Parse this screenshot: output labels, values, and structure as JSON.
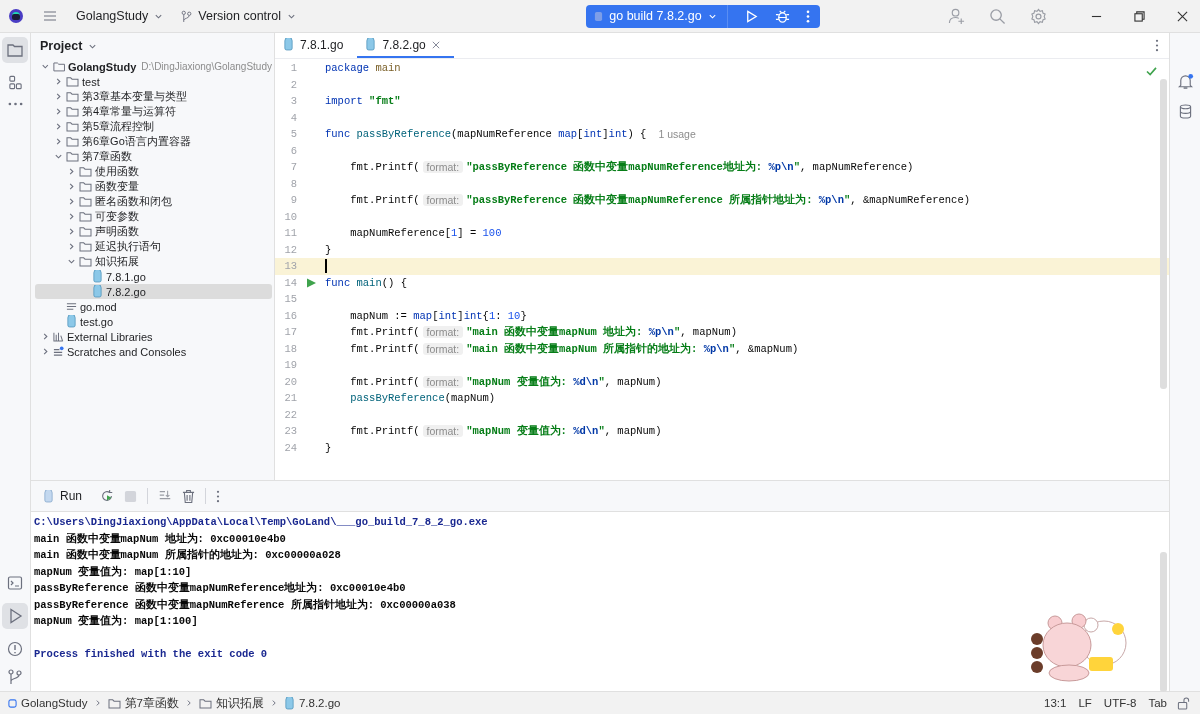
{
  "title_bar": {
    "project": "GolangStudy",
    "vcs": "Version control",
    "run_config": "go build 7.8.2.go"
  },
  "project_panel": {
    "title": "Project",
    "tree": [
      {
        "label": "GolangStudy",
        "path": "D:\\DingJiaxiong\\GolangStudy",
        "kind": "folder",
        "expanded": true,
        "selected": false,
        "children": [
          {
            "label": "test",
            "kind": "folder",
            "expanded": false,
            "selected": false
          },
          {
            "label": "第3章基本变量与类型",
            "kind": "folder",
            "expanded": false,
            "selected": false
          },
          {
            "label": "第4章常量与运算符",
            "kind": "folder",
            "expanded": false,
            "selected": false
          },
          {
            "label": "第5章流程控制",
            "kind": "folder",
            "expanded": false,
            "selected": false
          },
          {
            "label": "第6章Go语言内置容器",
            "kind": "folder",
            "expanded": false,
            "selected": false
          },
          {
            "label": "第7章函数",
            "kind": "folder",
            "expanded": true,
            "selected": false,
            "children": [
              {
                "label": "使用函数",
                "kind": "folder",
                "expanded": false,
                "selected": false
              },
              {
                "label": "函数变量",
                "kind": "folder",
                "expanded": false,
                "selected": false
              },
              {
                "label": "匿名函数和闭包",
                "kind": "folder",
                "expanded": false,
                "selected": false
              },
              {
                "label": "可变参数",
                "kind": "folder",
                "expanded": false,
                "selected": false
              },
              {
                "label": "声明函数",
                "kind": "folder",
                "expanded": false,
                "selected": false
              },
              {
                "label": "延迟执行语句",
                "kind": "folder",
                "expanded": false,
                "selected": false
              },
              {
                "label": "知识拓展",
                "kind": "folder",
                "expanded": true,
                "selected": false,
                "children": [
                  {
                    "label": "7.8.1.go",
                    "kind": "go_file",
                    "selected": false
                  },
                  {
                    "label": "7.8.2.go",
                    "kind": "go_file",
                    "selected": true
                  }
                ]
              }
            ]
          },
          {
            "label": "go.mod",
            "kind": "mod_file",
            "selected": false
          },
          {
            "label": "test.go",
            "kind": "go_file",
            "selected": false
          }
        ]
      },
      {
        "label": "External Libraries",
        "kind": "library",
        "expanded": false,
        "selected": false
      },
      {
        "label": "Scratches and Consoles",
        "kind": "scratches",
        "expanded": false,
        "selected": false
      }
    ]
  },
  "editor": {
    "tabs": [
      {
        "label": "7.8.1.go",
        "selected": false
      },
      {
        "label": "7.8.2.go",
        "selected": true
      }
    ],
    "lines": [
      {
        "number": "1",
        "current": false,
        "run_marker": false,
        "tokens": [
          {
            "text": "package",
            "kind": "keyword"
          },
          {
            "text": " main",
            "kind": "package"
          }
        ]
      },
      {
        "number": "2",
        "current": false,
        "run_marker": false
      },
      {
        "number": "3",
        "current": false,
        "run_marker": false,
        "tokens": [
          {
            "text": "import",
            "kind": "keyword"
          },
          {
            "text": " \"fmt\"",
            "kind": "string"
          }
        ]
      },
      {
        "number": "4",
        "current": false,
        "run_marker": false
      },
      {
        "number": "5",
        "current": false,
        "run_marker": false,
        "tokens": [
          {
            "text": "func",
            "kind": "keyword"
          },
          {
            "text": " passByReference",
            "kind": "function"
          },
          {
            "text": "(mapNumReference ",
            "kind": "plain"
          },
          {
            "text": "map",
            "kind": "keyword"
          },
          {
            "text": "[",
            "kind": "plain"
          },
          {
            "text": "int",
            "kind": "keyword"
          },
          {
            "text": "]",
            "kind": "plain"
          },
          {
            "text": "int",
            "kind": "keyword"
          },
          {
            "text": ") {",
            "kind": "plain"
          },
          {
            "text": "1 usage",
            "kind": "usage"
          }
        ]
      },
      {
        "number": "6",
        "current": false,
        "run_marker": false
      },
      {
        "number": "7",
        "current": false,
        "run_marker": false,
        "tokens": [
          {
            "text": "    fmt.Printf(",
            "kind": "call"
          },
          {
            "text": "format:",
            "kind": "hint"
          },
          {
            "text": "\"passByReference 函数中变量mapNumReference地址为: ",
            "kind": "string"
          },
          {
            "text": "%p\\n",
            "kind": "escape"
          },
          {
            "text": "\"",
            "kind": "string"
          },
          {
            "text": ", mapNumReference)",
            "kind": "plain"
          }
        ]
      },
      {
        "number": "8",
        "current": false,
        "run_marker": false
      },
      {
        "number": "9",
        "current": false,
        "run_marker": false,
        "tokens": [
          {
            "text": "    fmt.Printf(",
            "kind": "call"
          },
          {
            "text": "format:",
            "kind": "hint"
          },
          {
            "text": "\"passByReference 函数中变量mapNumReference 所属指针地址为: ",
            "kind": "string"
          },
          {
            "text": "%p\\n",
            "kind": "escape"
          },
          {
            "text": "\"",
            "kind": "string"
          },
          {
            "text": ", &mapNumReference)",
            "kind": "plain"
          }
        ]
      },
      {
        "number": "10",
        "current": false,
        "run_marker": false
      },
      {
        "number": "11",
        "current": false,
        "run_marker": false,
        "tokens": [
          {
            "text": "    mapNumReference[",
            "kind": "plain"
          },
          {
            "text": "1",
            "kind": "number"
          },
          {
            "text": "] = ",
            "kind": "plain"
          },
          {
            "text": "100",
            "kind": "number"
          }
        ]
      },
      {
        "number": "12",
        "current": false,
        "run_marker": false,
        "tokens": [
          {
            "text": "}",
            "kind": "plain"
          }
        ]
      },
      {
        "number": "13",
        "current": true,
        "run_marker": false
      },
      {
        "number": "14",
        "current": false,
        "run_marker": true,
        "tokens": [
          {
            "text": "func",
            "kind": "keyword"
          },
          {
            "text": " main",
            "kind": "function"
          },
          {
            "text": "() {",
            "kind": "plain"
          }
        ]
      },
      {
        "number": "15",
        "current": false,
        "run_marker": false
      },
      {
        "number": "16",
        "current": false,
        "run_marker": false,
        "tokens": [
          {
            "text": "    mapNum := ",
            "kind": "plain"
          },
          {
            "text": "map",
            "kind": "keyword"
          },
          {
            "text": "[",
            "kind": "plain"
          },
          {
            "text": "int",
            "kind": "keyword"
          },
          {
            "text": "]",
            "kind": "plain"
          },
          {
            "text": "int",
            "kind": "keyword"
          },
          {
            "text": "{",
            "kind": "plain"
          },
          {
            "text": "1",
            "kind": "number"
          },
          {
            "text": ": ",
            "kind": "plain"
          },
          {
            "text": "10",
            "kind": "number"
          },
          {
            "text": "}",
            "kind": "plain"
          }
        ]
      },
      {
        "number": "17",
        "current": false,
        "run_marker": false,
        "tokens": [
          {
            "text": "    fmt.Printf(",
            "kind": "call"
          },
          {
            "text": "format:",
            "kind": "hint"
          },
          {
            "text": "\"main 函数中变量mapNum 地址为: ",
            "kind": "string"
          },
          {
            "text": "%p\\n",
            "kind": "escape"
          },
          {
            "text": "\"",
            "kind": "string"
          },
          {
            "text": ", mapNum)",
            "kind": "plain"
          }
        ]
      },
      {
        "number": "18",
        "current": false,
        "run_marker": false,
        "tokens": [
          {
            "text": "    fmt.Printf(",
            "kind": "call"
          },
          {
            "text": "format:",
            "kind": "hint"
          },
          {
            "text": "\"main 函数中变量mapNum 所属指针的地址为: ",
            "kind": "string"
          },
          {
            "text": "%p\\n",
            "kind": "escape"
          },
          {
            "text": "\"",
            "kind": "string"
          },
          {
            "text": ", &mapNum)",
            "kind": "plain"
          }
        ]
      },
      {
        "number": "19",
        "current": false,
        "run_marker": false
      },
      {
        "number": "20",
        "current": false,
        "run_marker": false,
        "tokens": [
          {
            "text": "    fmt.Printf(",
            "kind": "call"
          },
          {
            "text": "format:",
            "kind": "hint"
          },
          {
            "text": "\"mapNum 变量值为: ",
            "kind": "string"
          },
          {
            "text": "%d\\n",
            "kind": "escape"
          },
          {
            "text": "\"",
            "kind": "string"
          },
          {
            "text": ", mapNum)",
            "kind": "plain"
          }
        ]
      },
      {
        "number": "21",
        "current": false,
        "run_marker": false,
        "tokens": [
          {
            "text": "    passByReference",
            "kind": "function"
          },
          {
            "text": "(mapNum)",
            "kind": "plain"
          }
        ]
      },
      {
        "number": "22",
        "current": false,
        "run_marker": false
      },
      {
        "number": "23",
        "current": false,
        "run_marker": false,
        "tokens": [
          {
            "text": "    fmt.Printf(",
            "kind": "call"
          },
          {
            "text": "format:",
            "kind": "hint"
          },
          {
            "text": "\"mapNum 变量值为: ",
            "kind": "string"
          },
          {
            "text": "%d\\n",
            "kind": "escape"
          },
          {
            "text": "\"",
            "kind": "string"
          },
          {
            "text": ", mapNum)",
            "kind": "plain"
          }
        ]
      },
      {
        "number": "24",
        "current": false,
        "run_marker": false,
        "tokens": [
          {
            "text": "}",
            "kind": "plain"
          }
        ]
      }
    ]
  },
  "run_panel": {
    "tab": "Run",
    "console": [
      {
        "text": "C:\\Users\\DingJiaxiong\\AppData\\Local\\Temp\\GoLand\\___go_build_7_8_2_go.exe",
        "kind": "command"
      },
      {
        "text": "main 函数中变量mapNum 地址为: 0xc00010e4b0",
        "kind": "output"
      },
      {
        "text": "main 函数中变量mapNum 所属指针的地址为: 0xc00000a028",
        "kind": "output"
      },
      {
        "text": "mapNum 变量值为: map[1:10]",
        "kind": "output"
      },
      {
        "text": "passByReference 函数中变量mapNumReference地址为: 0xc00010e4b0",
        "kind": "output"
      },
      {
        "text": "passByReference 函数中变量mapNumReference 所属指针地址为: 0xc00000a038",
        "kind": "output"
      },
      {
        "text": "mapNum 变量值为: map[1:100]",
        "kind": "output"
      },
      {
        "text": "Process finished with the exit code 0",
        "kind": "exit"
      }
    ]
  },
  "status_bar": {
    "breadcrumbs": [
      {
        "label": "GolangStudy",
        "kind": "project"
      },
      {
        "label": "第7章函数",
        "kind": "folder"
      },
      {
        "label": "知识拓展",
        "kind": "folder"
      },
      {
        "label": "7.8.2.go",
        "kind": "go_file"
      }
    ],
    "position": "13:1",
    "line_ending": "LF",
    "encoding": "UTF-8",
    "indent": "Tab"
  }
}
